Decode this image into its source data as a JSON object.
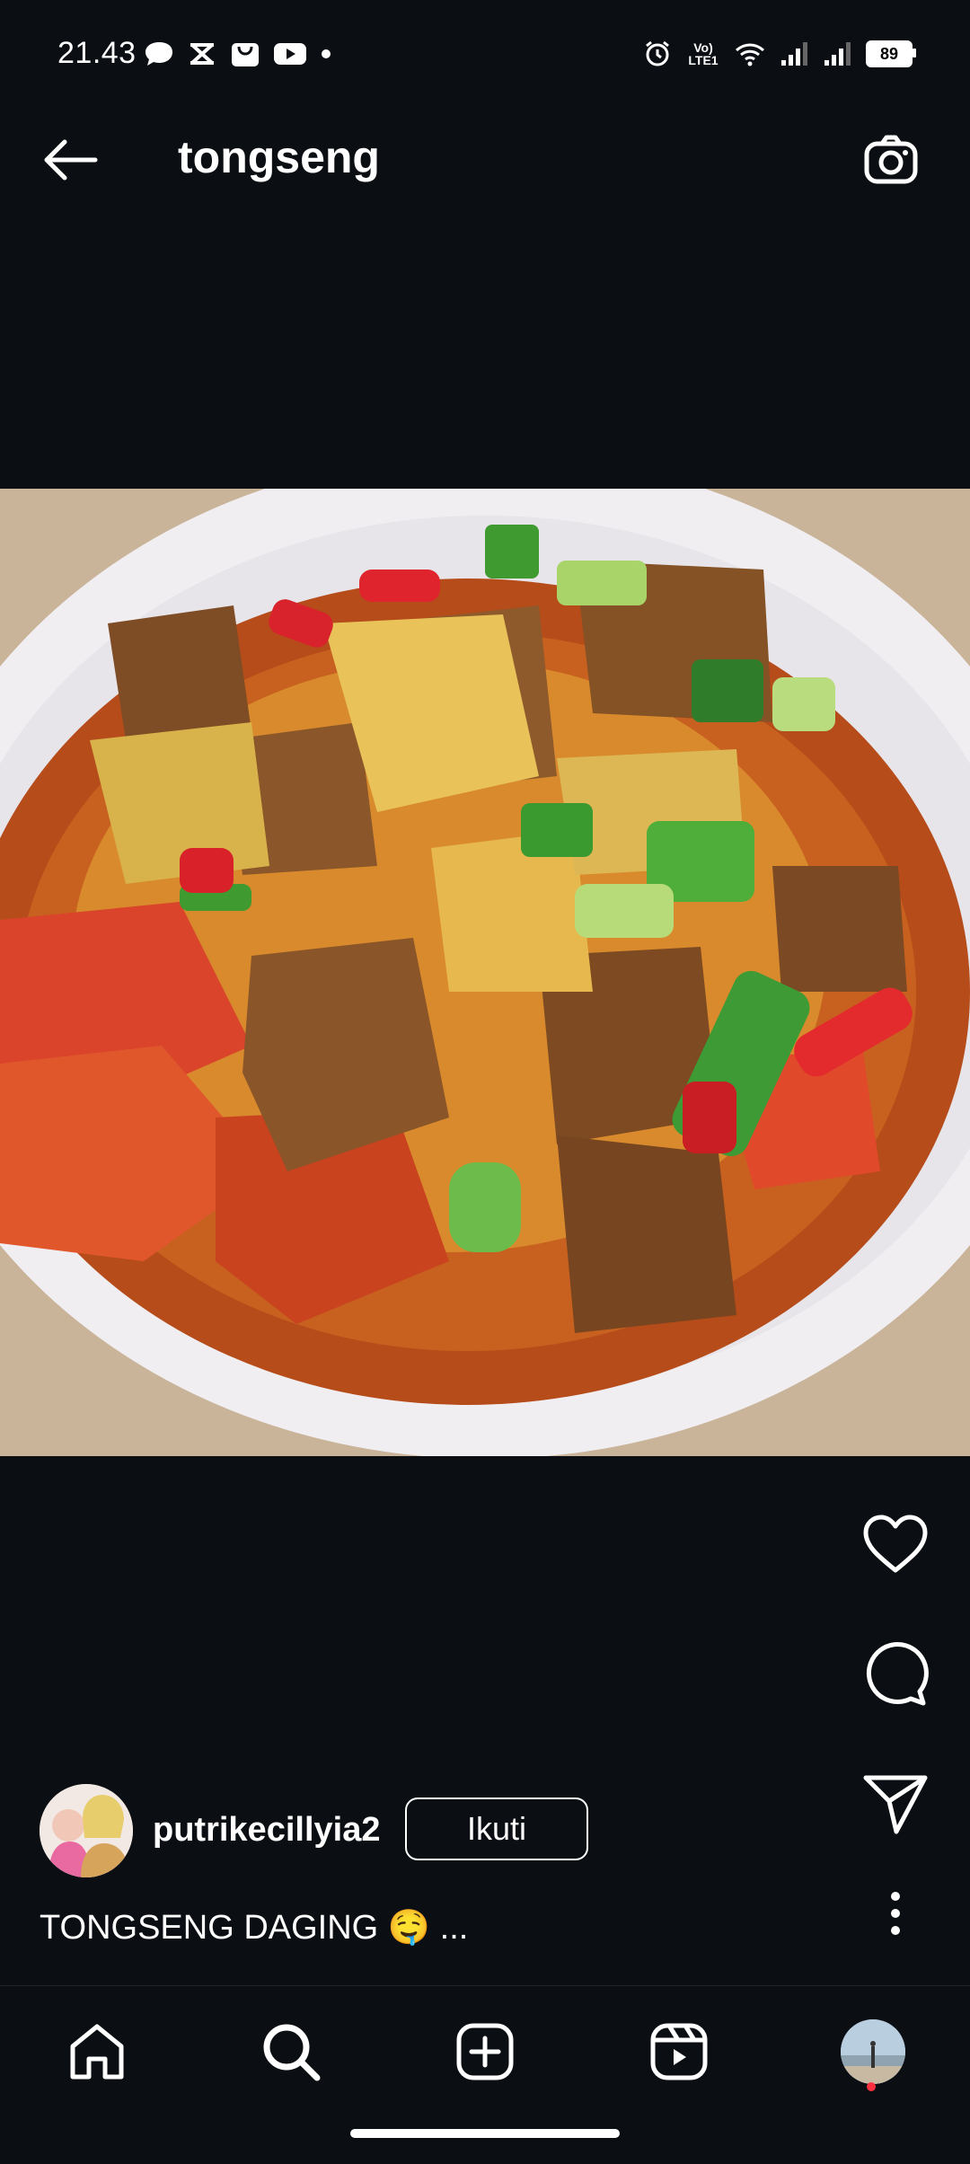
{
  "status_bar": {
    "time": "21.43",
    "battery": "89",
    "network_label": "Vo) LTE1"
  },
  "header": {
    "title": "tongseng"
  },
  "post": {
    "username": "putrikecillyia2",
    "follow_label": "Ikuti",
    "caption": "TONGSENG DAGING 🤤 ..."
  },
  "icons": {
    "back": "back-arrow-icon",
    "camera": "camera-icon",
    "like": "heart-icon",
    "comment": "comment-icon",
    "share": "send-icon",
    "more": "more-vertical-icon",
    "home": "home-icon",
    "search": "search-icon",
    "create": "plus-square-icon",
    "reels": "reels-icon"
  },
  "colors": {
    "background": "#0b0f14",
    "notification_dot": "#ff3040"
  }
}
